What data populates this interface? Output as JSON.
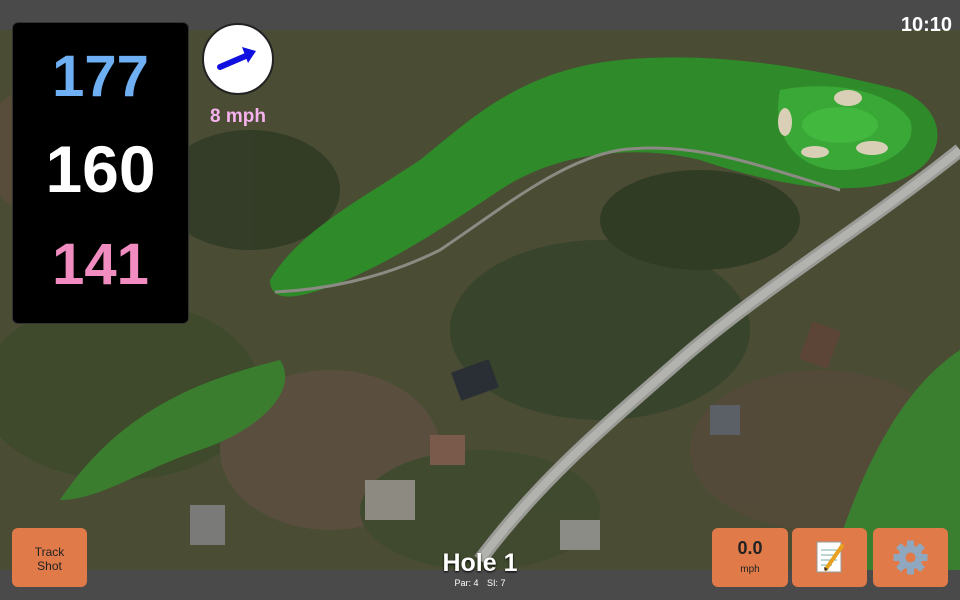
{
  "status": {
    "time": "10:10"
  },
  "distances": {
    "back": "177",
    "center": "160",
    "front": "141"
  },
  "wind": {
    "speed_label": "8 mph",
    "icon": "wind-arrow-icon"
  },
  "buttons": {
    "track_shot_label": "Track Shot",
    "speed_value": "0.0",
    "speed_unit": "mph",
    "notes_icon": "notepad-icon",
    "settings_icon": "gear-icon"
  },
  "hole": {
    "title": "Hole 1",
    "par_label": "Par: 4",
    "si_label": "SI: 7"
  },
  "colors": {
    "back_distance": "#6fb0f5",
    "center_distance": "#ffffff",
    "front_distance": "#f08cc0",
    "wind_speed": "#f5b2ee",
    "button_bg": "#e07a49",
    "wind_arrow": "#1010e0"
  }
}
